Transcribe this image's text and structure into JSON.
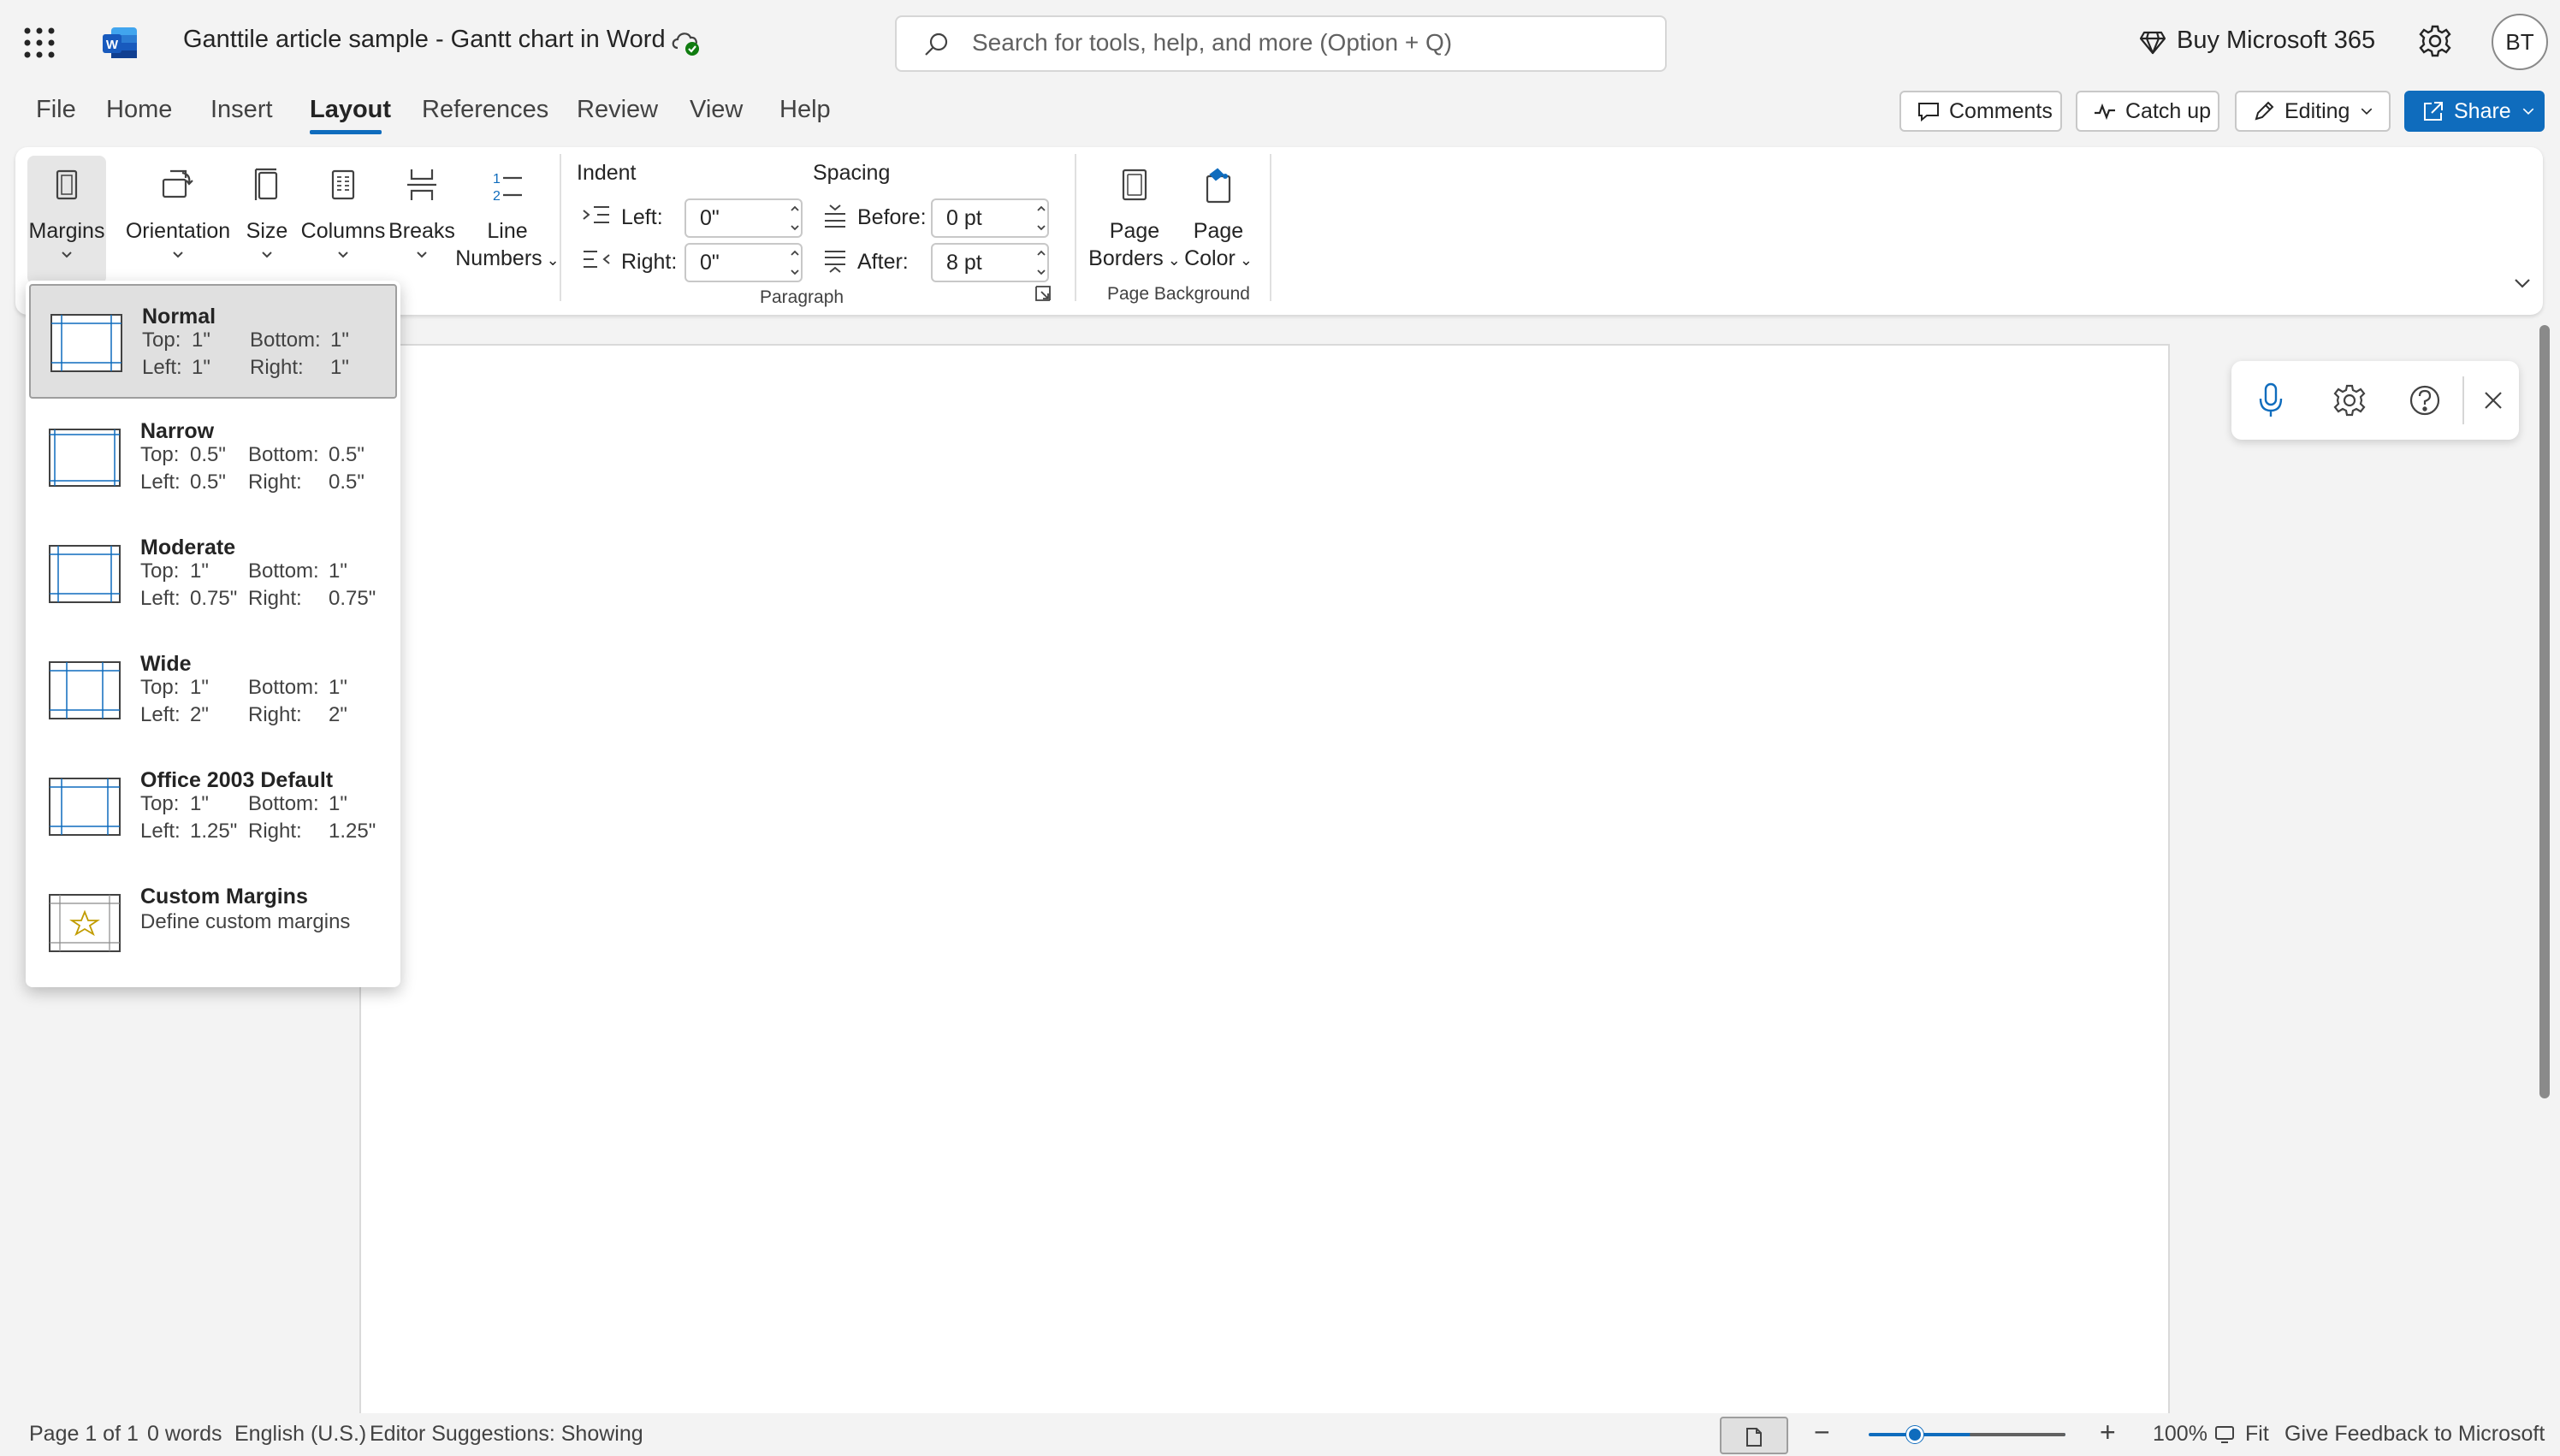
{
  "titlebar": {
    "doc_title": "Ganttile article sample - Gantt chart in Word",
    "search_placeholder": "Search for tools, help, and more (Option + Q)",
    "buy_label": "Buy Microsoft 365",
    "avatar_initials": "BT"
  },
  "tabs": [
    "File",
    "Home",
    "Insert",
    "Layout",
    "References",
    "Review",
    "View",
    "Help"
  ],
  "active_tab": "Layout",
  "top_buttons": {
    "comments": "Comments",
    "catch_up": "Catch up",
    "editing": "Editing",
    "share": "Share"
  },
  "ribbon": {
    "page_setup": {
      "margins": "Margins",
      "orientation": "Orientation",
      "size": "Size",
      "columns": "Columns",
      "breaks": "Breaks",
      "line_numbers_1": "Line",
      "line_numbers_2": "Numbers"
    },
    "paragraph": {
      "indent_title": "Indent",
      "spacing_title": "Spacing",
      "left_label": "Left:",
      "left_value": "0\"",
      "right_label": "Right:",
      "right_value": "0\"",
      "before_label": "Before:",
      "before_value": "0 pt",
      "after_label": "After:",
      "after_value": "8 pt",
      "group_label": "Paragraph"
    },
    "page_background": {
      "page_borders_1": "Page",
      "page_borders_2": "Borders",
      "page_color_1": "Page",
      "page_color_2": "Color",
      "group_label": "Page Background"
    }
  },
  "margins_menu": {
    "items": [
      {
        "name": "Normal",
        "top_label": "Top:",
        "top": "1\"",
        "bottom_label": "Bottom:",
        "bottom": "1\"",
        "left_label": "Left:",
        "left": "1\"",
        "right_label": "Right:",
        "right": "1\""
      },
      {
        "name": "Narrow",
        "top_label": "Top:",
        "top": "0.5\"",
        "bottom_label": "Bottom:",
        "bottom": "0.5\"",
        "left_label": "Left:",
        "left": "0.5\"",
        "right_label": "Right:",
        "right": "0.5\""
      },
      {
        "name": "Moderate",
        "top_label": "Top:",
        "top": "1\"",
        "bottom_label": "Bottom:",
        "bottom": "1\"",
        "left_label": "Left:",
        "left": "0.75\"",
        "right_label": "Right:",
        "right": "0.75\""
      },
      {
        "name": "Wide",
        "top_label": "Top:",
        "top": "1\"",
        "bottom_label": "Bottom:",
        "bottom": "1\"",
        "left_label": "Left:",
        "left": "2\"",
        "right_label": "Right:",
        "right": "2\""
      },
      {
        "name": "Office 2003 Default",
        "top_label": "Top:",
        "top": "1\"",
        "bottom_label": "Bottom:",
        "bottom": "1\"",
        "left_label": "Left:",
        "left": "1.25\"",
        "right_label": "Right:",
        "right": "1.25\""
      }
    ],
    "custom": {
      "name": "Custom Margins",
      "description": "Define custom margins"
    }
  },
  "statusbar": {
    "page": "Page 1 of 1",
    "words": "0 words",
    "language": "English (U.S.)",
    "editor": "Editor Suggestions: Showing",
    "zoom_minus": "−",
    "zoom_plus": "+",
    "zoom_percent": "100%",
    "fit": "Fit",
    "feedback": "Give Feedback to Microsoft"
  },
  "colors": {
    "accent": "#0f6cbd",
    "word_brand": "#185abd",
    "selected_item_bg": "#e0e0e0"
  },
  "icons": {
    "app_launcher": "waffle-icon",
    "word": "word-logo",
    "saved": "cloud-check-icon",
    "search": "search-icon",
    "premium": "diamond-icon",
    "settings": "gear-icon",
    "dictate": "microphone-icon",
    "help": "help-icon",
    "close": "close-icon"
  }
}
